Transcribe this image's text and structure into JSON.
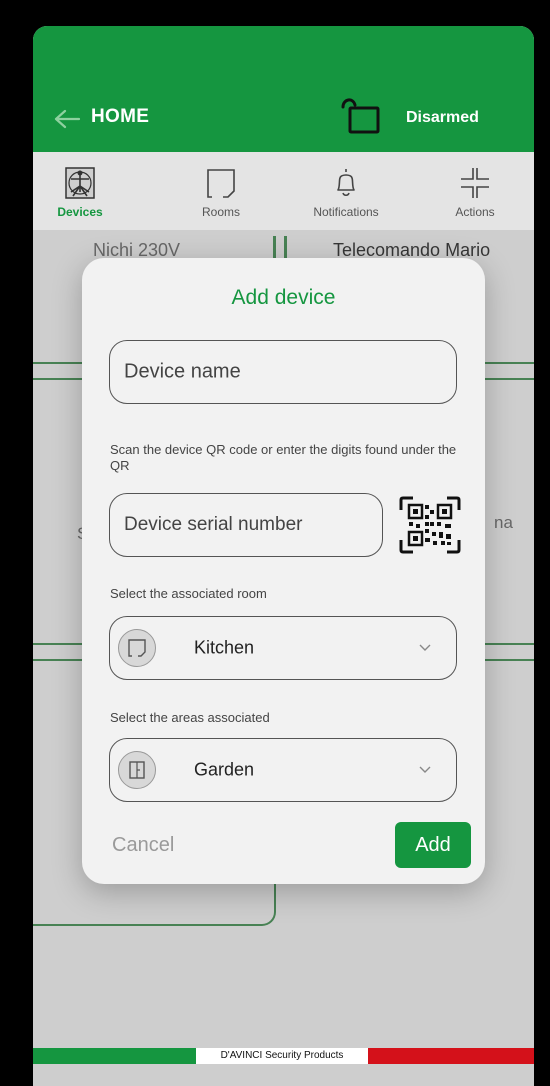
{
  "header": {
    "title": "HOME",
    "status": "Disarmed"
  },
  "tabs": [
    {
      "label": "Devices",
      "icon": "vitruvian-icon",
      "active": true
    },
    {
      "label": "Rooms",
      "icon": "room-icon",
      "active": false
    },
    {
      "label": "Notifications",
      "icon": "bell-icon",
      "active": false
    },
    {
      "label": "Actions",
      "icon": "actions-icon",
      "active": false
    }
  ],
  "background": {
    "device_left": "Nichi 230V",
    "device_right": "Telecomando Mario",
    "partial_right": "na",
    "partial_left": "S"
  },
  "dialog": {
    "title": "Add device",
    "name_placeholder": "Device name",
    "qr_hint": "Scan the device QR code or enter the digits found under the QR",
    "serial_placeholder": "Device serial number",
    "room_label": "Select the associated room",
    "room_value": "Kitchen",
    "area_label": "Select the areas associated",
    "area_value": "Garden",
    "cancel_label": "Cancel",
    "add_label": "Add"
  },
  "footer": {
    "brand": "D'AVINCI Security Products"
  },
  "colors": {
    "brand_green": "#159640",
    "brand_red": "#d4111a"
  }
}
